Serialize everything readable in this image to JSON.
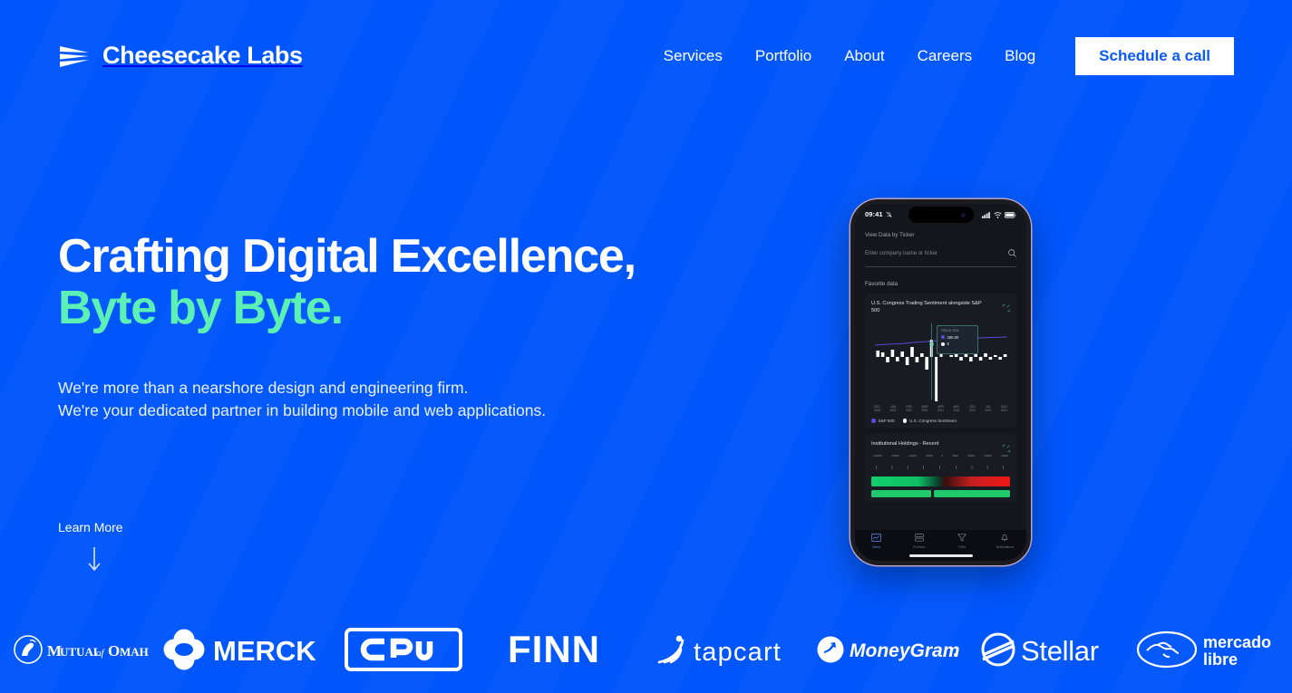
{
  "brand": {
    "name": "Cheesecake Labs",
    "logo_icon": "cheesecake-labs-mark",
    "background_color": "#0056FB",
    "accent_color": "#5DF0B4",
    "text_color": "#FFFFFF"
  },
  "nav": {
    "items": [
      {
        "label": "Services"
      },
      {
        "label": "Portfolio"
      },
      {
        "label": "About"
      },
      {
        "label": "Careers"
      },
      {
        "label": "Blog"
      }
    ],
    "cta": {
      "label": "Schedule a call"
    }
  },
  "hero": {
    "headline_line1": "Crafting Digital Excellence,",
    "headline_line2": "Byte by Byte.",
    "subhead_line1": "We're more than a nearshore design and engineering firm.",
    "subhead_line2": "We're your dedicated partner in building mobile and web applications.",
    "learn_more": "Learn More",
    "learn_more_icon": "arrow-down-icon"
  },
  "phone": {
    "status": {
      "time": "09:41",
      "silent_icon": "bell-slash-icon",
      "signal_icon": "cellular-signal-icon",
      "wifi_icon": "wifi-icon",
      "battery_icon": "battery-icon"
    },
    "ticker_section_label": "View Data by Ticker",
    "search_placeholder": "Enter company name or ticker",
    "search_icon": "search-icon",
    "favorites_label": "Favorite data",
    "cards": [
      {
        "title": "U.S. Congress Trading Sentiment alongside S&P 500",
        "expand_icon": "expand-icon",
        "tooltip": {
          "date": "FEB 02 2021",
          "rows": [
            {
              "color": "#5b4bd6",
              "value": "390.00"
            },
            {
              "color": "#ffffff",
              "value": "6"
            }
          ]
        },
        "legend": [
          {
            "label": "S&P 500",
            "color": "#5b4bd6"
          },
          {
            "label": "U.S. Congress Sentiment",
            "color": "#ffffff"
          }
        ]
      },
      {
        "title": "Institutional Holdings - Recent",
        "expand_icon": "expand-icon",
        "ticks": [
          "+200M",
          "+150M",
          "+100M",
          "+50M",
          "0",
          "-50M",
          "-100M",
          "-150M",
          "-200M"
        ]
      }
    ],
    "tabs": [
      {
        "label": "Home",
        "icon": "chart-line-icon",
        "active": true
      },
      {
        "label": "Portfolio",
        "icon": "layers-icon",
        "active": false
      },
      {
        "label": "Filter",
        "icon": "funnel-icon",
        "active": false
      },
      {
        "label": "Notifications",
        "icon": "bell-icon",
        "active": false
      }
    ]
  },
  "chart_data": {
    "type": "bar",
    "title": "U.S. Congress Trading Sentiment alongside S&P 500",
    "categories": [
      "DEC 2020",
      "JAN 2021",
      "FEB 2021",
      "MAR 2021",
      "APR 2021",
      "MAY 2021",
      "JUN 2021",
      "JUL 2021",
      "AUG 2021"
    ],
    "series": [
      {
        "name": "S&P 500",
        "color": "#5b4bd6",
        "type": "line",
        "values": [
          368,
          374,
          390,
          396,
          417,
          420,
          428,
          438,
          451
        ]
      },
      {
        "name": "U.S. Congress Sentiment",
        "color": "#ffffff",
        "type": "bar",
        "values": [
          4,
          -3,
          6,
          -28,
          5,
          -4,
          3,
          2,
          -2
        ]
      }
    ],
    "xlabel": "",
    "ylabel": "",
    "grid": false,
    "legend_position": "bottom-left",
    "annotation": {
      "date": "FEB 02 2021",
      "sp500": 390.0,
      "sentiment": 6
    }
  },
  "client_logos": [
    {
      "name": "Mutual of Omaha",
      "icon": "mutual-of-omaha-logo"
    },
    {
      "name": "MERCK",
      "icon": "merck-logo"
    },
    {
      "name": "CRU",
      "icon": "cru-logo"
    },
    {
      "name": "FINN",
      "icon": "finn-logo"
    },
    {
      "name": "tapcart",
      "icon": "tapcart-logo"
    },
    {
      "name": "MoneyGram",
      "icon": "moneygram-logo"
    },
    {
      "name": "Stellar",
      "icon": "stellar-logo"
    },
    {
      "name": "mercado libre",
      "icon": "mercado-libre-logo"
    }
  ]
}
